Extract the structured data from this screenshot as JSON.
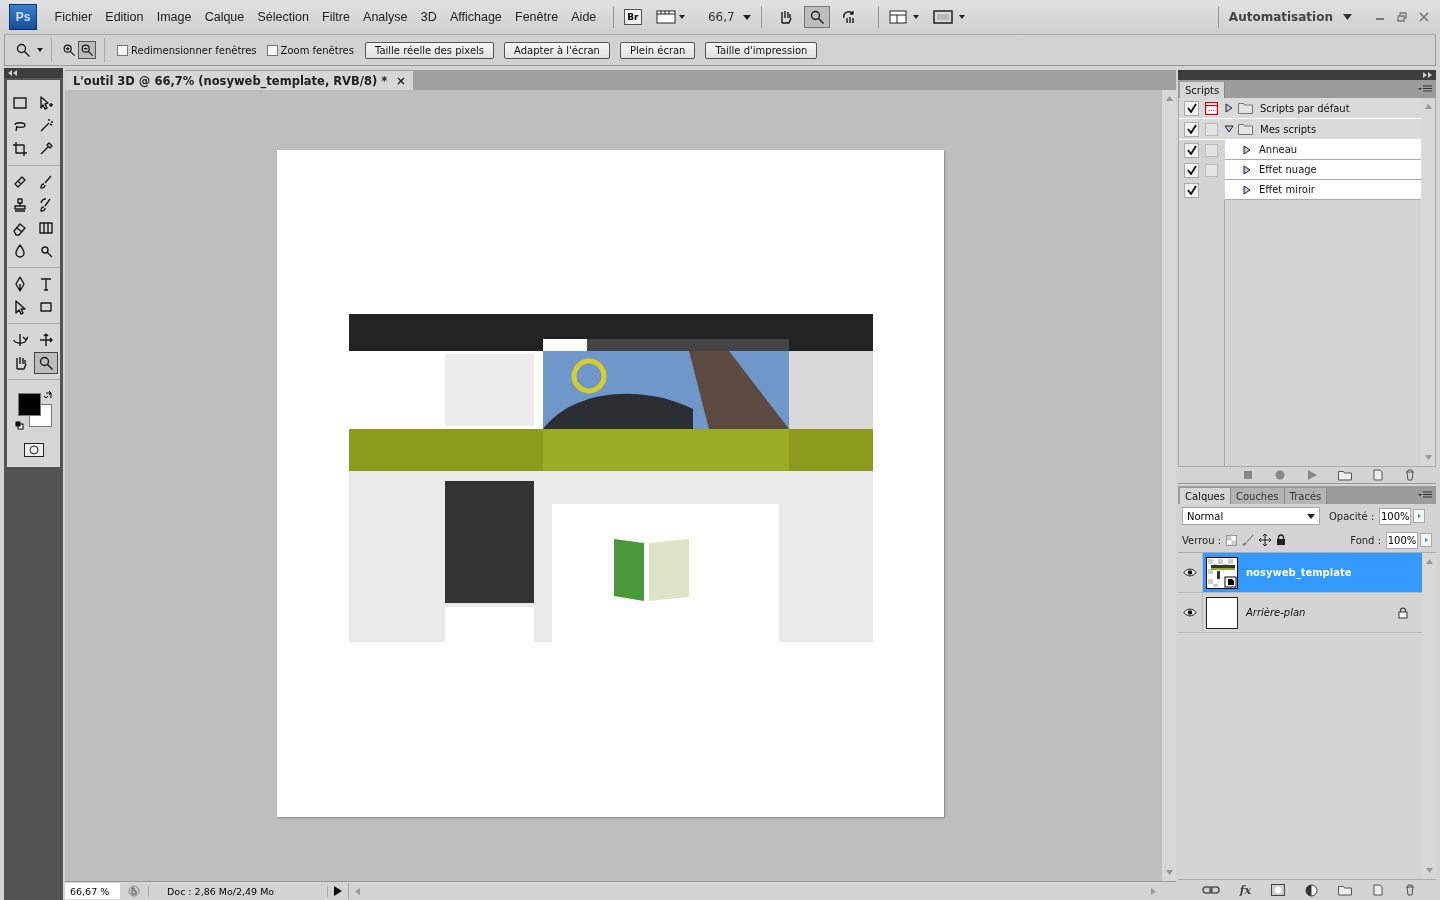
{
  "menu_bar": {
    "logo": "Ps",
    "items": [
      "Fichier",
      "Edition",
      "Image",
      "Calque",
      "Sélection",
      "Filtre",
      "Analyse",
      "3D",
      "Affichage",
      "Fenêtre",
      "Aide"
    ],
    "bridge": "Br",
    "zoom": "66,7",
    "view_tools": [
      {
        "kind": "hand",
        "selected": false
      },
      {
        "kind": "zoom",
        "selected": true
      },
      {
        "kind": "rotate-view",
        "selected": false
      }
    ],
    "workspace": "Automatisation"
  },
  "options_bar": {
    "zoom_buttons": [
      {
        "kind": "zoom-in",
        "selected": false
      },
      {
        "kind": "zoom-out",
        "selected": true
      }
    ],
    "checkboxes": [
      {
        "label": "Redimensionner fenêtres",
        "checked": false
      },
      {
        "label": "Zoom fenêtres",
        "checked": false
      }
    ],
    "buttons": [
      "Taille réelle des pixels",
      "Adapter à l'écran",
      "Plein écran",
      "Taille d'impression"
    ]
  },
  "tools": [
    [
      {
        "kind": "marquee",
        "selected": false
      },
      {
        "kind": "move",
        "selected": false
      },
      {
        "kind": "lasso",
        "selected": false
      },
      {
        "kind": "magic-wand",
        "selected": false
      },
      {
        "kind": "crop",
        "selected": false
      },
      {
        "kind": "eyedropper",
        "selected": false
      }
    ],
    [
      {
        "kind": "healing",
        "selected": false
      },
      {
        "kind": "brush",
        "selected": false
      },
      {
        "kind": "stamp",
        "selected": false
      },
      {
        "kind": "history-brush",
        "selected": false
      },
      {
        "kind": "eraser",
        "selected": false
      },
      {
        "kind": "gradient",
        "selected": false
      },
      {
        "kind": "blur",
        "selected": false
      },
      {
        "kind": "dodge",
        "selected": false
      }
    ],
    [
      {
        "kind": "pen",
        "selected": false
      },
      {
        "kind": "type",
        "selected": false
      },
      {
        "kind": "path-select",
        "selected": false
      },
      {
        "kind": "shape",
        "selected": false
      }
    ],
    [
      {
        "kind": "rotate-3d",
        "selected": false
      },
      {
        "kind": "orbit-3d",
        "selected": false
      },
      {
        "kind": "hand",
        "selected": false
      },
      {
        "kind": "zoom",
        "selected": true
      }
    ]
  ],
  "document": {
    "tab": "L'outil 3D @ 66,7% (nosyweb_template, RVB/8) *"
  },
  "status_bar": {
    "zoom": "66,67 %",
    "info": "Doc : 2,86 Mo/2,49 Mo"
  },
  "scripts_panel": {
    "title": "Scripts",
    "items": [
      {
        "label": "Scripts par défaut",
        "checked": true,
        "dialog": true,
        "expanded": false
      },
      {
        "label": "Mes scripts",
        "checked": true,
        "dialog": false,
        "expanded": true,
        "children": [
          {
            "label": "Anneau",
            "checked": true,
            "dialog": false
          },
          {
            "label": "Effet nuage",
            "checked": true,
            "dialog": false
          },
          {
            "label": "Effet miroir",
            "checked": true
          }
        ]
      }
    ]
  },
  "layers_panel": {
    "tabs": [
      {
        "label": "Calques",
        "selected": true
      },
      {
        "label": "Couches",
        "selected": false
      },
      {
        "label": "Tracés",
        "selected": false
      }
    ],
    "blend_mode": "Normal",
    "opacity_label": "Opacité :",
    "opacity": "100%",
    "lock_label": "Verrou :",
    "fill_label": "Fond :",
    "fill": "100%",
    "layers": [
      {
        "name": "nosyweb_template",
        "kind": "smart-object",
        "visible": true,
        "selected": true,
        "locked": false
      },
      {
        "name": "Arrière-plan",
        "kind": "background",
        "visible": true,
        "selected": false,
        "locked": true
      }
    ],
    "fx": "fx"
  }
}
